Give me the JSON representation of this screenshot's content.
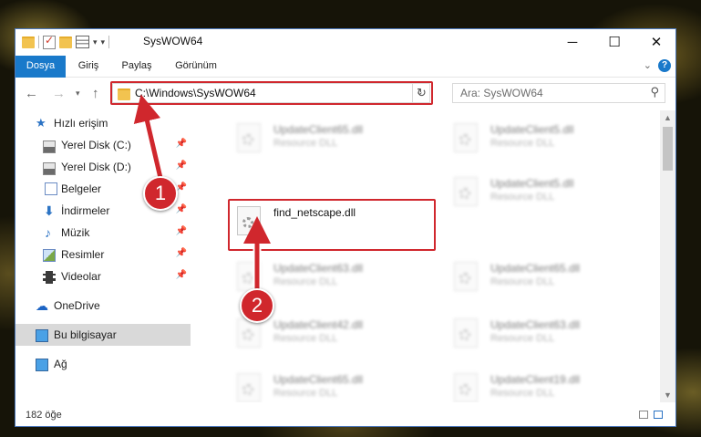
{
  "window": {
    "title": "SysWOW64",
    "controls": {
      "minimize": "─",
      "maximize": "☐",
      "close": "✕"
    }
  },
  "ribbon": {
    "tabs": [
      "Dosya",
      "Giriş",
      "Paylaş",
      "Görünüm"
    ],
    "accent": "#1979ca",
    "help": "?"
  },
  "address": {
    "path": "C:\\Windows\\SysWOW64",
    "search_placeholder": "Ara: SysWOW64"
  },
  "nav_pane": {
    "items": [
      {
        "label": "Hızlı erişim",
        "icon": "star-icon"
      },
      {
        "label": "Yerel Disk (C:)",
        "icon": "drive-icon",
        "pinned": true
      },
      {
        "label": "Yerel Disk (D:)",
        "icon": "drive-icon",
        "pinned": true
      },
      {
        "label": "Belgeler",
        "icon": "documents-icon",
        "pinned": true
      },
      {
        "label": "İndirmeler",
        "icon": "downloads-icon",
        "pinned": true
      },
      {
        "label": "Müzik",
        "icon": "music-icon",
        "pinned": true
      },
      {
        "label": "Resimler",
        "icon": "pictures-icon",
        "pinned": true
      },
      {
        "label": "Videolar",
        "icon": "videos-icon",
        "pinned": true
      },
      {
        "label": "OneDrive",
        "icon": "onedrive-icon"
      },
      {
        "label": "Bu bilgisayar",
        "icon": "this-pc-icon",
        "selected": true
      },
      {
        "label": "Ağ",
        "icon": "network-icon"
      }
    ]
  },
  "files": {
    "highlighted": {
      "name": "find_netscape.dll"
    },
    "left_column": [
      {
        "name": "UpdateClient65.dll",
        "type": "Resource DLL"
      },
      {
        "name": "UpdateClient63.dll",
        "type": "Resource DLL"
      },
      {
        "name": "UpdateClient42.dll",
        "type": "Resource DLL"
      },
      {
        "name": "UpdateClient65.dll",
        "type": "Resource DLL"
      }
    ],
    "right_column": [
      {
        "name": "UpdateClient5.dll",
        "type": "Resource DLL"
      },
      {
        "name": "UpdateClient5.dll",
        "type": "Resource DLL"
      },
      {
        "name": "UpdateClient65.dll",
        "type": "Resource DLL"
      },
      {
        "name": "UpdateClient63.dll",
        "type": "Resource DLL"
      },
      {
        "name": "UpdateClient19.dll",
        "type": "Resource DLL"
      }
    ]
  },
  "status": {
    "item_count": "182 öğe"
  },
  "annotations": {
    "step1": "1",
    "step2": "2",
    "color": "#d0272d"
  }
}
